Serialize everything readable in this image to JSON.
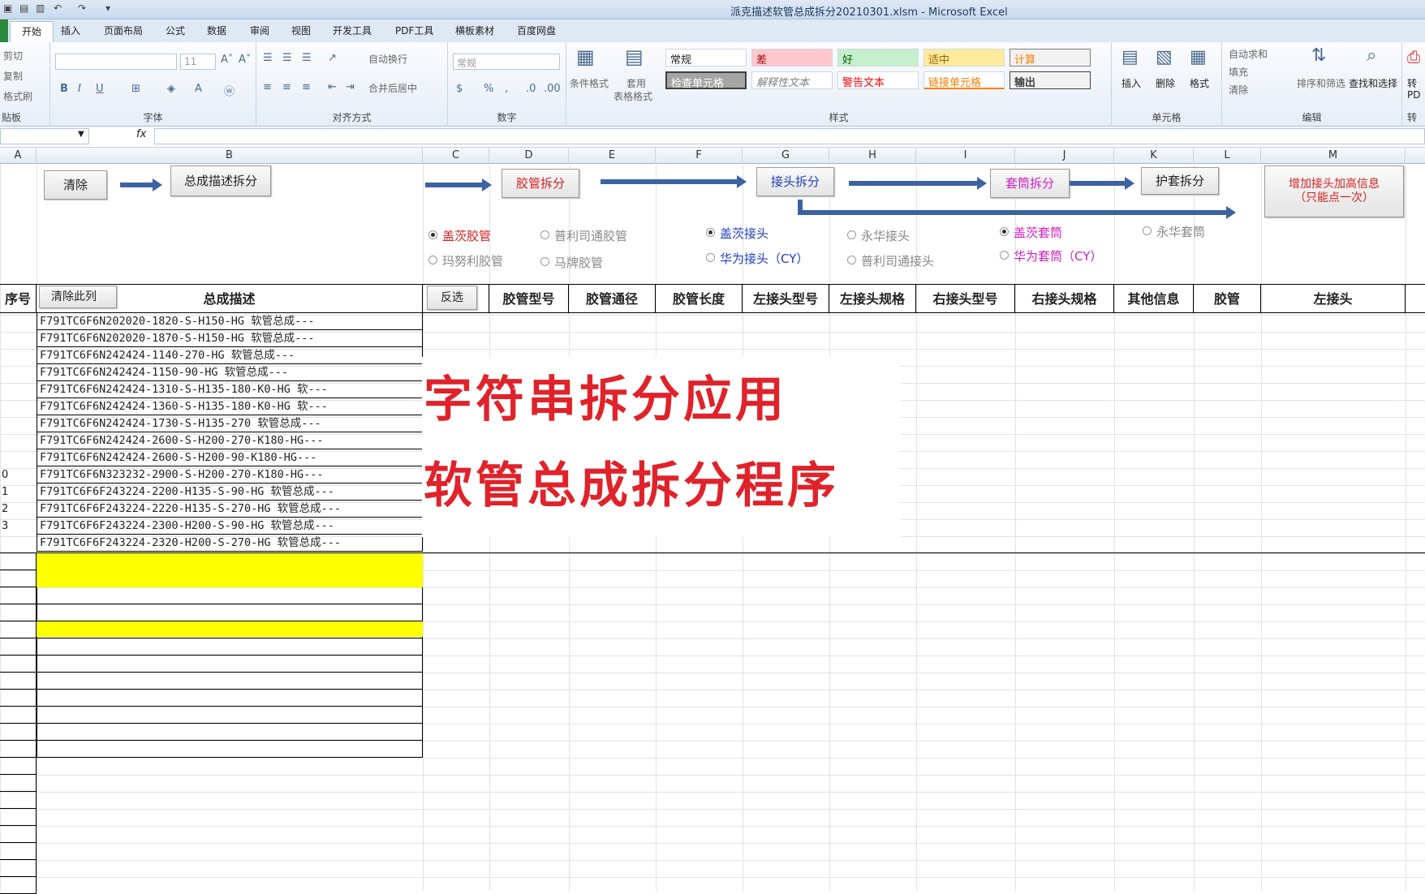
{
  "window": {
    "title": "派克描述软管总成拆分20210301.xlsm - Microsoft Excel"
  },
  "tabs": [
    "开始",
    "插入",
    "页面布局",
    "公式",
    "数据",
    "审阅",
    "视图",
    "开发工具",
    "PDF工具",
    "横板素材",
    "百度网盘"
  ],
  "ribbon": {
    "clipboard": {
      "cut": "剪切",
      "copy": "复制",
      "format_painter": "格式刷",
      "label": "贴板"
    },
    "font": {
      "size": "11",
      "label": "字体"
    },
    "alignment": {
      "wrap": "自动换行",
      "merge": "合并后居中",
      "label": "对齐方式"
    },
    "number": {
      "format": "常规",
      "label": "数字"
    },
    "styles": {
      "conditional": "条件格式",
      "table": "套用",
      "table2": "表格格式",
      "cells": [
        "常规",
        "差",
        "好",
        "适中",
        "计算",
        "检查单元格",
        "解释性文本",
        "警告文本",
        "链接单元格",
        "输出"
      ],
      "label": "样式"
    },
    "cells": {
      "insert": "插入",
      "delete": "删除",
      "format": "格式",
      "label": "单元格"
    },
    "editing": {
      "autosum": "自动求和",
      "fill": "填充",
      "clear": "清除",
      "sort": "排序和筛选",
      "find": "查找和选择",
      "label": "编辑"
    },
    "pdf": {
      "label1": "转",
      "label2": "PD",
      "label3": "转"
    }
  },
  "columns": [
    "A",
    "B",
    "C",
    "D",
    "E",
    "F",
    "G",
    "H",
    "I",
    "J",
    "K",
    "L",
    "M"
  ],
  "buttons": {
    "clear": "清除",
    "split_desc": "总成描述拆分",
    "hose_split": "胶管拆分",
    "fitting_split": "接头拆分",
    "sleeve_split": "套筒拆分",
    "guard_split": "护套拆分",
    "add_info": "增加接头加高信息",
    "add_info2": "（只能点一次）",
    "clear_col": "清除此列",
    "invert": "反选"
  },
  "options": {
    "hose": [
      "盖茨胶管",
      "普利司通胶管",
      "玛努利胶管",
      "马牌胶管"
    ],
    "fitting": [
      "盖茨接头",
      "永华接头",
      "华为接头（CY）",
      "普利司通接头"
    ],
    "sleeve": [
      "盖茨套筒",
      "永华套筒",
      "华为套筒（CY）"
    ]
  },
  "headers": {
    "seq": "序号",
    "desc": "总成描述",
    "hose_model": "胶管型号",
    "hose_dia": "胶管通径",
    "hose_len": "胶管长度",
    "lf_model": "左接头型号",
    "lf_spec": "左接头规格",
    "rf_model": "右接头型号",
    "rf_spec": "右接头规格",
    "other": "其他信息",
    "hose": "胶管",
    "left": "左接头"
  },
  "rows": [
    {
      "n": "",
      "d": "F791TC6F6N202020-1820-S-H150-HG 软管总成---"
    },
    {
      "n": "",
      "d": "F791TC6F6N202020-1870-S-H150-HG 软管总成---"
    },
    {
      "n": "",
      "d": "F791TC6F6N242424-1140-270-HG 软管总成---"
    },
    {
      "n": "",
      "d": "F791TC6F6N242424-1150-90-HG 软管总成---"
    },
    {
      "n": "",
      "d": "F791TC6F6N242424-1310-S-H135-180-K0-HG 软---"
    },
    {
      "n": "",
      "d": "F791TC6F6N242424-1360-S-H135-180-K0-HG 软---"
    },
    {
      "n": "",
      "d": "F791TC6F6N242424-1730-S-H135-270 软管总成---"
    },
    {
      "n": "",
      "d": "F791TC6F6N242424-2600-S-H200-270-K180-HG---"
    },
    {
      "n": "",
      "d": "F791TC6F6N242424-2600-S-H200-90-K180-HG---"
    },
    {
      "n": "0",
      "d": "F791TC6F6N323232-2900-S-H200-270-K180-HG---"
    },
    {
      "n": "1",
      "d": "F791TC6F6F243224-2200-H135-S-90-HG 软管总成---"
    },
    {
      "n": "2",
      "d": "F791TC6F6F243224-2220-H135-S-270-HG 软管总成---"
    },
    {
      "n": "3",
      "d": "F791TC6F6F243224-2300-H200-S-90-HG 软管总成---"
    },
    {
      "n": "",
      "d": "F791TC6F6F243224-2320-H200-S-270-HG 软管总成---"
    }
  ],
  "overlay": {
    "line1": "字符串拆分应用",
    "line2": "软管总成拆分程序"
  },
  "colors": {
    "accent": "#3d62a0",
    "overlay_text": "#e0222a",
    "highlight": "#ffff00"
  }
}
